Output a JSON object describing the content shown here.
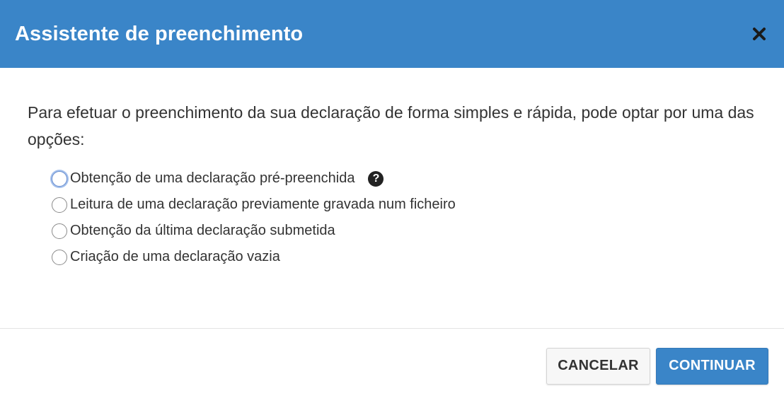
{
  "dialog": {
    "title": "Assistente de preenchimento",
    "close_icon": "close-icon",
    "intro": "Para efetuar o preenchimento da sua declaração de forma simples e rápida, pode optar por uma das opções:",
    "options": [
      {
        "label": "Obtenção de uma declaração pré-preenchida",
        "selected": false,
        "focused": true,
        "help_icon": "question-circle-icon",
        "help_glyph": "?"
      },
      {
        "label": "Leitura de uma declaração previamente gravada num ficheiro",
        "selected": false
      },
      {
        "label": "Obtenção da última declaração submetida",
        "selected": false
      },
      {
        "label": "Criação de uma declaração vazia",
        "selected": false
      }
    ],
    "buttons": {
      "cancel_label": "CANCELAR",
      "continue_label": "CONTINUAR"
    }
  },
  "colors": {
    "header_bg": "#3a85c8",
    "primary_button": "#3a85c8",
    "text": "#333333"
  }
}
